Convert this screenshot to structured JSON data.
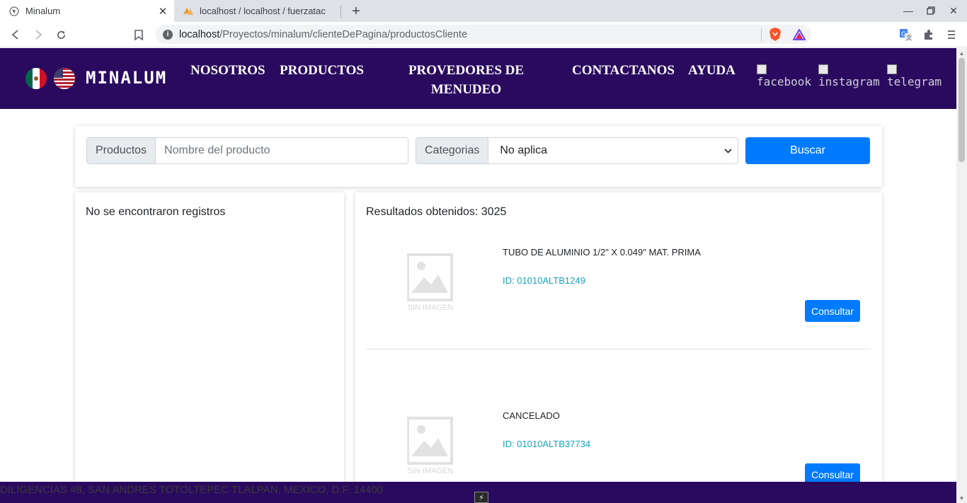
{
  "browser": {
    "tabs": [
      {
        "title": "Minalum",
        "active": true
      },
      {
        "title": "localhost / localhost / fuerzatac",
        "active": false
      }
    ],
    "url_host": "localhost",
    "url_path": "/Proyectos/minalum/clienteDePagina/productosCliente"
  },
  "header": {
    "brand": "MINALUM",
    "nav": [
      "NOSOTROS",
      "PRODUCTOS",
      "PROVEDORES DE MENUDEO",
      "CONTACTANOS",
      "AYUDA"
    ],
    "social": [
      "facebook",
      "instagram",
      "telegram"
    ]
  },
  "search": {
    "productos_label": "Productos",
    "productos_placeholder": "Nombre del producto",
    "categorias_label": "Categorias",
    "categorias_value": "No aplica",
    "buscar_label": "Buscar"
  },
  "left_panel": {
    "message": "No se encontraron registros"
  },
  "results": {
    "summary": "Resultados obtenidos: 3025",
    "image_placeholder": "SIN IMAGEN",
    "consultar_label": "Consultar",
    "items": [
      {
        "name": "TUBO DE ALUMINIO 1/2\" X 0.049\" MAT. PRIMA",
        "id": "ID: 01010ALTB1249"
      },
      {
        "name": "CANCELADO",
        "id": "ID: 01010ALTB37734"
      }
    ]
  },
  "footer": {
    "address": "DILIGENCIAS #8, SAN ANDRES TOTOLTEPEC TLALPAN, MEXICO, D.F. 14400"
  },
  "colors": {
    "header_bg": "#2a0a5f",
    "primary": "#007bff",
    "id_text": "#17a2b8"
  }
}
